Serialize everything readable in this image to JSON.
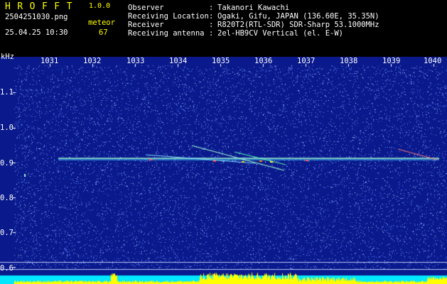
{
  "app": {
    "name": "HROFFT",
    "version": "1.0.0"
  },
  "capture": {
    "filename": "2504251030.png",
    "datetime": "25.04.25 10:30",
    "count_label": "meteor",
    "count_value": "67"
  },
  "info": [
    {
      "label": "Observer",
      "value": "Takanori Kawachi"
    },
    {
      "label": "Receiving Location",
      "value": "Ogaki, Gifu, JAPAN (136.60E, 35.35N)"
    },
    {
      "label": "Receiver",
      "value": "R820T2(RTL-SDR) SDR-Sharp 53.1000MHz"
    },
    {
      "label": "Receiving antenna",
      "value": "2el-HB9CV Vertical (el. E-W)"
    }
  ],
  "axes": {
    "unit": "kHz",
    "x_ticks": [
      "1031",
      "1032",
      "1033",
      "1034",
      "1035",
      "1036",
      "1037",
      "1038",
      "1039",
      "1040"
    ],
    "y_ticks": [
      "1.1",
      "1.0",
      "0.9",
      "0.8",
      "0.7",
      "0.6"
    ]
  },
  "colors": {
    "background": "#0a1a8c",
    "noise": "#6a8cff",
    "signal": "#9ff7d0",
    "level": "#00e8ff",
    "peak": "#ffff00",
    "header_text": "#ffff00"
  }
}
